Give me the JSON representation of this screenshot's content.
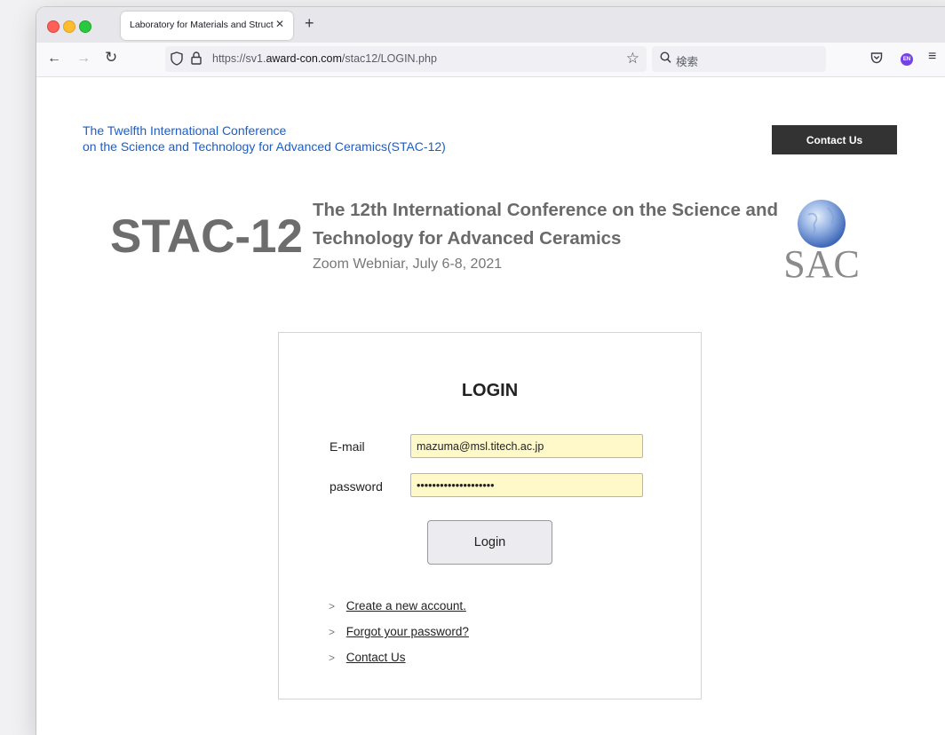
{
  "browser": {
    "tab_title": "Laboratory for Materials and Structures",
    "tab_close": "✕",
    "new_tab": "+",
    "url_prefix": "https://sv1.",
    "url_host": "award-con.com",
    "url_path": "/stac12/LOGIN.php",
    "search_placeholder": "検索",
    "extension_badge": "EN"
  },
  "site": {
    "title_line1": "The Twelfth International Conference",
    "title_line2": "on the Science and Technology for Advanced Ceramics(STAC-12)",
    "contact_button": "Contact Us",
    "logo_text": "STAC-12",
    "conference_line1": "The 12th International Conference on the Science and",
    "conference_line2": "Technology for Advanced Ceramics",
    "conference_date": "Zoom Webniar, July 6-8, 2021",
    "emblem_text": "SAC"
  },
  "login": {
    "heading": "LOGIN",
    "email_label": "E-mail",
    "email_value": "mazuma@msl.titech.ac.jp",
    "password_label": "password",
    "password_value": "••••••••••••••••••••",
    "submit_label": "Login",
    "links": [
      {
        "marker": ">",
        "label": "Create a new account."
      },
      {
        "marker": ">",
        "label": "Forgot your password?"
      },
      {
        "marker": ">",
        "label": "Contact Us"
      }
    ]
  },
  "colors": {
    "accent_link": "#1b5ec8",
    "input_background": "#fff8c8",
    "contact_button_bg": "#333333"
  }
}
